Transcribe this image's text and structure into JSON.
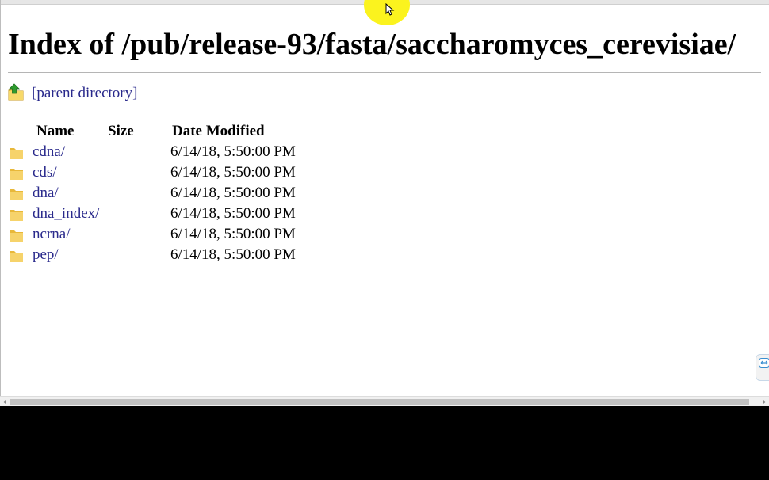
{
  "page": {
    "title": "Index of /pub/release-93/fasta/saccharomyces_cerevisiae/",
    "parent_link": "[parent directory]"
  },
  "table": {
    "headers": {
      "name": "Name",
      "size": "Size",
      "date": "Date Modified"
    },
    "rows": [
      {
        "name": "cdna/",
        "size": "",
        "date": "6/14/18, 5:50:00 PM",
        "icon": "folder-icon"
      },
      {
        "name": "cds/",
        "size": "",
        "date": "6/14/18, 5:50:00 PM",
        "icon": "folder-icon"
      },
      {
        "name": "dna/",
        "size": "",
        "date": "6/14/18, 5:50:00 PM",
        "icon": "folder-icon"
      },
      {
        "name": "dna_index/",
        "size": "",
        "date": "6/14/18, 5:50:00 PM",
        "icon": "folder-icon"
      },
      {
        "name": "ncrna/",
        "size": "",
        "date": "6/14/18, 5:50:00 PM",
        "icon": "folder-icon"
      },
      {
        "name": "pep/",
        "size": "",
        "date": "6/14/18, 5:50:00 PM",
        "icon": "folder-icon"
      }
    ]
  },
  "colors": {
    "link": "#2a2a8c",
    "cursor_highlight": "#fbf31e",
    "folder": "#f2c94c",
    "parent_arrow": "#2e9a2e"
  }
}
